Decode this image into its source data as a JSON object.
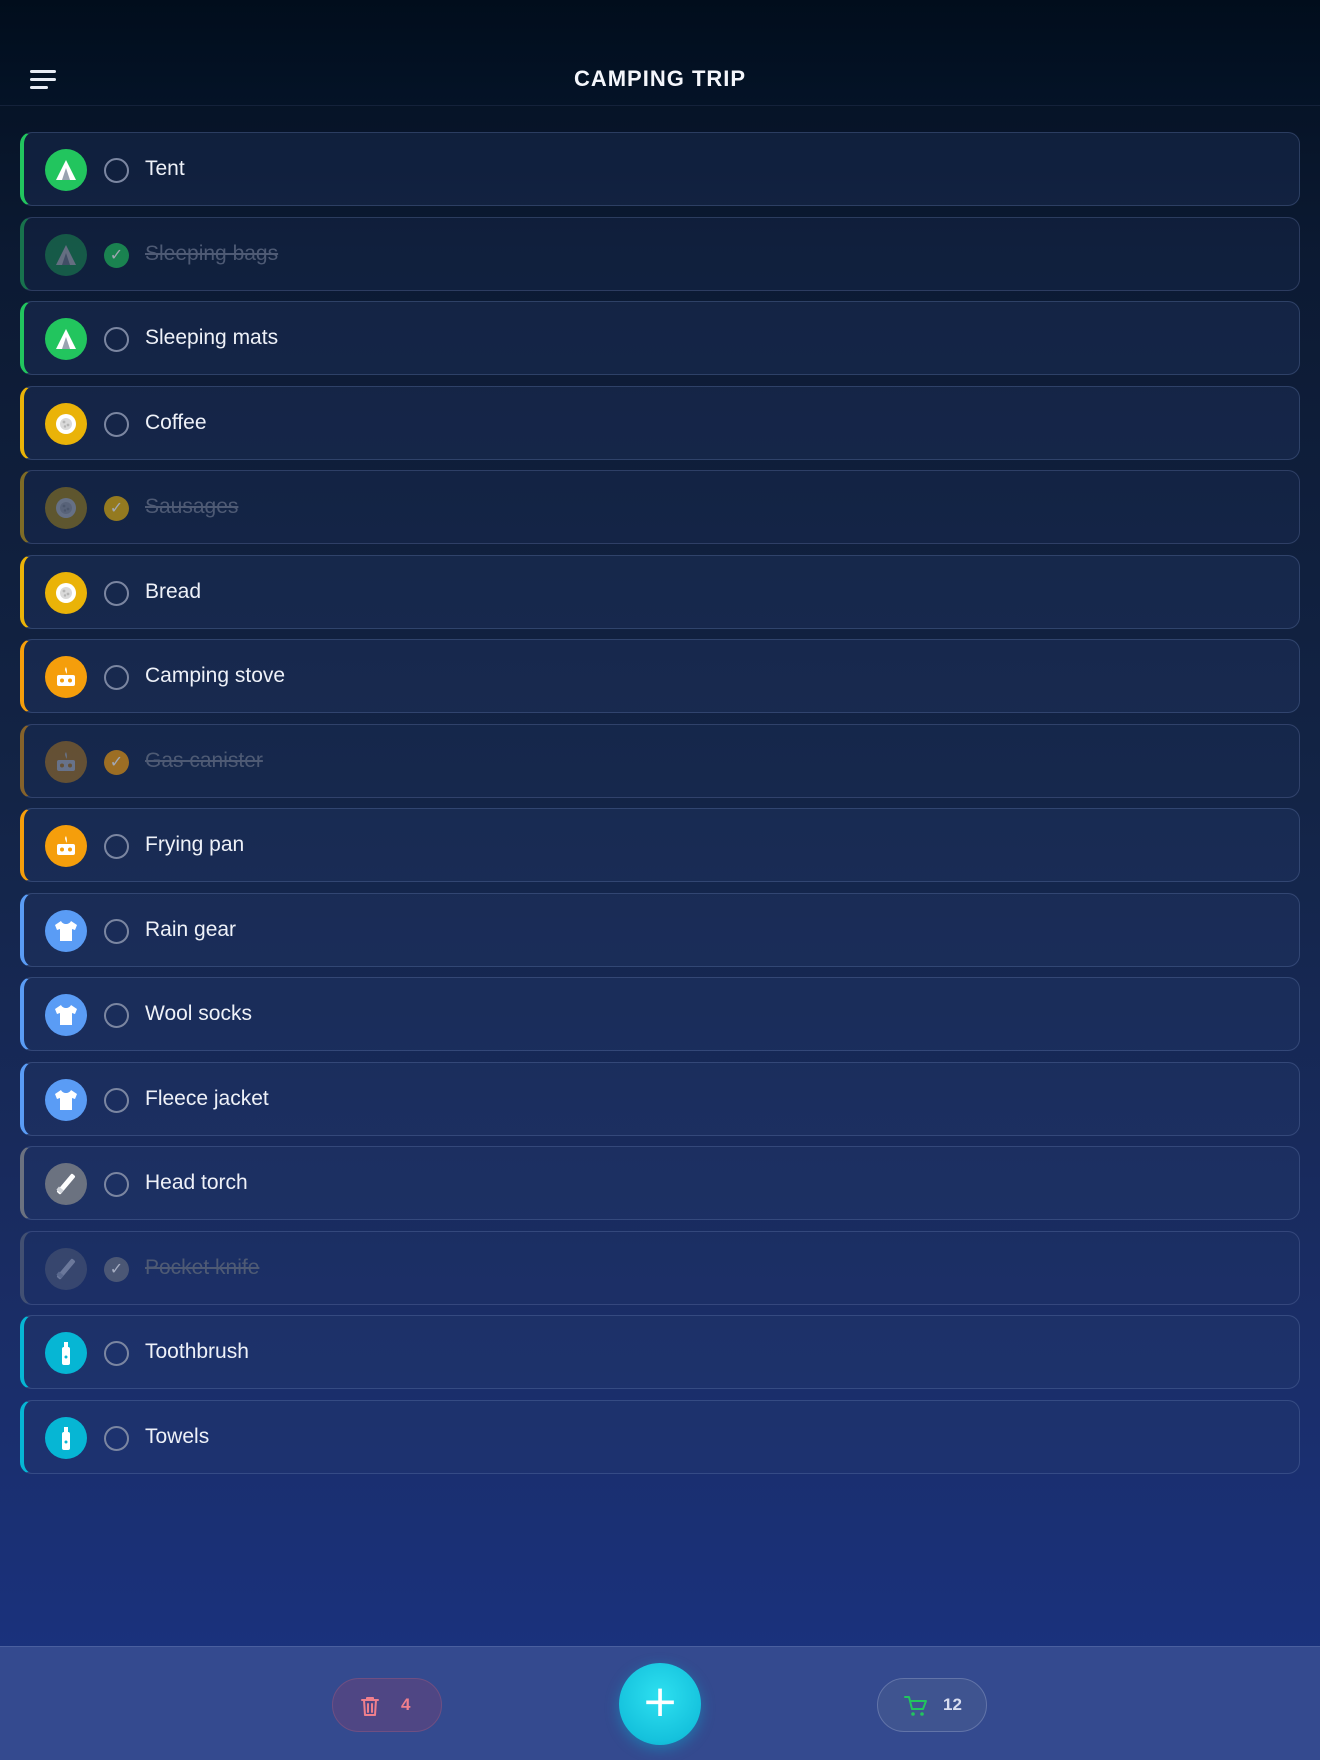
{
  "header": {
    "title": "CAMPING TRIP"
  },
  "items": [
    {
      "label": "Tent",
      "category": "tent-icon",
      "color": "#22c55e",
      "done": false
    },
    {
      "label": "Sleeping bags",
      "category": "tent-icon",
      "color": "#22c55e",
      "done": true
    },
    {
      "label": "Sleeping mats",
      "category": "tent-icon",
      "color": "#22c55e",
      "done": false
    },
    {
      "label": "Coffee",
      "category": "food-icon",
      "color": "#eab308",
      "done": false
    },
    {
      "label": "Sausages",
      "category": "food-icon",
      "color": "#eab308",
      "done": true
    },
    {
      "label": "Bread",
      "category": "food-icon",
      "color": "#eab308",
      "done": false
    },
    {
      "label": "Camping stove",
      "category": "stove-icon",
      "color": "#f59e0b",
      "done": false
    },
    {
      "label": "Gas canister",
      "category": "stove-icon",
      "color": "#f59e0b",
      "done": true
    },
    {
      "label": "Frying pan",
      "category": "stove-icon",
      "color": "#f59e0b",
      "done": false
    },
    {
      "label": "Rain gear",
      "category": "shirt-icon",
      "color": "#5a9cf5",
      "done": false
    },
    {
      "label": "Wool socks",
      "category": "shirt-icon",
      "color": "#5a9cf5",
      "done": false
    },
    {
      "label": "Fleece jacket",
      "category": "shirt-icon",
      "color": "#5a9cf5",
      "done": false
    },
    {
      "label": "Head torch",
      "category": "tool-icon",
      "color": "#6b7280",
      "done": false
    },
    {
      "label": "Pocket knife",
      "category": "tool-icon",
      "color": "#6b7280",
      "done": true
    },
    {
      "label": "Toothbrush",
      "category": "toiletry-icon",
      "color": "#06b6d4",
      "done": false
    },
    {
      "label": "Towels",
      "category": "toiletry-icon",
      "color": "#06b6d4",
      "done": false
    }
  ],
  "footer": {
    "delete_count": "4",
    "cart_count": "12",
    "delete_icon": "trash-icon",
    "cart_icon": "cart-icon",
    "add_icon": "plus-icon"
  }
}
